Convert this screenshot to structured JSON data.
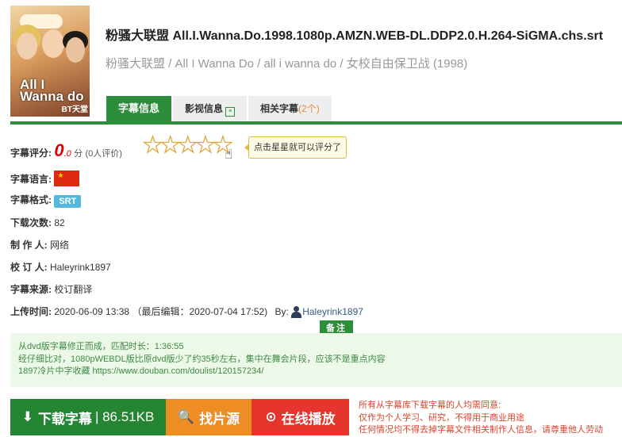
{
  "poster": {
    "title": "All I Wanna do",
    "watermark": "BT天堂"
  },
  "header": {
    "title": "粉骚大联盟 All.I.Wanna.Do.1998.1080p.AMZN.WEB-DL.DDP2.0.H.264-SiGMA.chs.srt",
    "subtitle": "粉骚大联盟 / All I Wanna Do / all i wanna do / 女校自由保卫战 (1998)"
  },
  "tabs": [
    {
      "label": "字幕信息"
    },
    {
      "label": "影视信息",
      "icon": "info-card-icon"
    },
    {
      "label": "相关字幕",
      "count": "(2个)"
    }
  ],
  "rating": {
    "label": "字幕评分:",
    "score_int": "0",
    "score_dec": ".0",
    "unit": "分",
    "count": "(0人评价)",
    "stars_total": 5,
    "stars_filled": 0,
    "tip": "点击星星就可以评分了"
  },
  "info": {
    "lang_label": "字幕语言:",
    "format_label": "字幕格式:",
    "format_value": "SRT",
    "downloads_label": "下载次数:",
    "downloads_value": "82",
    "maker_label": "制 作 人:",
    "maker_value": "网络",
    "reviewer_label": "校 订 人:",
    "reviewer_value": "Haleyrink1897",
    "source_label": "字幕来源:",
    "source_value": "校订翻译",
    "upload_label": "上传时间:",
    "upload_value": "2020-06-09 13:38",
    "edit_value": "（最后编辑：2020-07-04 17:52)",
    "by_label": "By:",
    "by_user": "Haleyrink1897"
  },
  "note": {
    "badge": "备注",
    "lines": [
      "从dvd版字幕修正而成，匹配时长：1:36:55",
      "经仔细比对，1080pWEBDL版比原dvd版少了约35秒左右，集中在舞会片段，应该不是重点内容",
      "1897冷片中字收藏 https://www.douban.com/doulist/120157234/"
    ]
  },
  "buttons": {
    "download": "下载字幕",
    "download_size": "| 86.51KB",
    "find_source": "找片源",
    "play": "在线播放"
  },
  "disclaimer": [
    "所有从字幕库下载字幕的人均需同意:",
    "仅作为个人学习、研究，不得用于商业用途",
    "任何情况均不得去掉字幕文件相关制作人信息，请尊重他人劳动"
  ],
  "colors": {
    "accent": "#2c8d3b",
    "orange": "#ef8d25",
    "red": "#e6352c",
    "score": "#dd0000"
  }
}
